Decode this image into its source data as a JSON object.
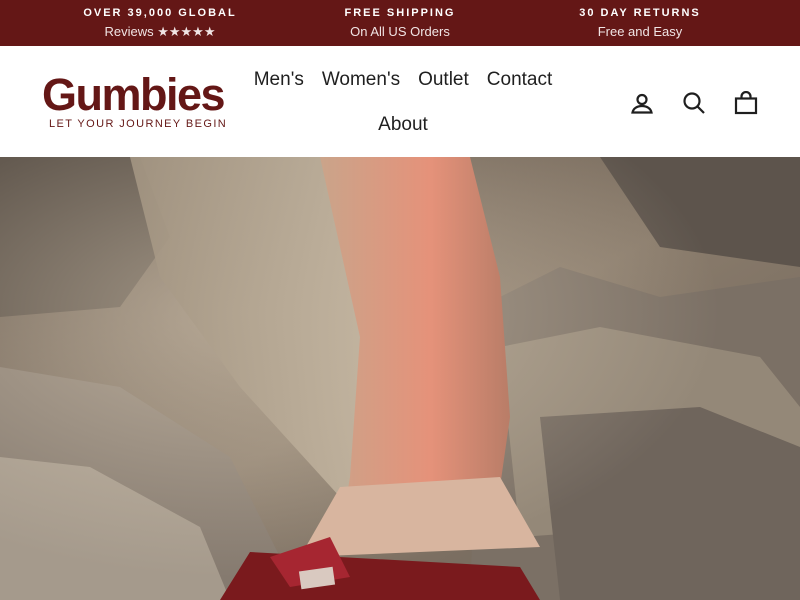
{
  "announcement": {
    "items": [
      {
        "title": "OVER 39,000 GLOBAL",
        "subtitle": "Reviews ★★★★★"
      },
      {
        "title": "FREE SHIPPING",
        "subtitle": "On All US Orders"
      },
      {
        "title": "30 DAY RETURNS",
        "subtitle": "Free and Easy"
      }
    ]
  },
  "header": {
    "logo": {
      "name": "Gumbies",
      "tagline": "LET YOUR JOURNEY BEGIN"
    },
    "nav": [
      "Men's",
      "Women's",
      "Outlet",
      "Contact",
      "About"
    ],
    "icons": [
      "account-icon",
      "search-icon",
      "cart-icon"
    ]
  },
  "hero": {
    "image": "feet-in-red-flip-flops-on-rocks"
  },
  "colors": {
    "brand": "#641716",
    "nav_text": "#1f1f1f",
    "background": "#ffffff"
  }
}
